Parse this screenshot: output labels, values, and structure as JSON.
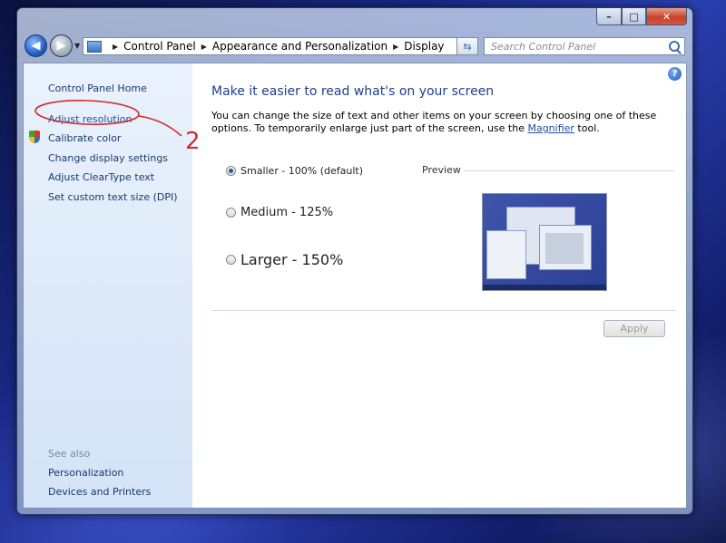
{
  "window": {
    "controls": {
      "minimize": "–",
      "maximize": "□",
      "close": "✕"
    }
  },
  "nav": {
    "back_glyph": "◀",
    "forward_glyph": "▶"
  },
  "address": {
    "crumbs": [
      "Control Panel",
      "Appearance and Personalization",
      "Display"
    ]
  },
  "search": {
    "placeholder": "Search Control Panel"
  },
  "sidebar": {
    "home": "Control Panel Home",
    "links": [
      "Adjust resolution",
      "Calibrate color",
      "Change display settings",
      "Adjust ClearType text",
      "Set custom text size (DPI)"
    ],
    "see_also_heading": "See also",
    "see_also": [
      "Personalization",
      "Devices and Printers"
    ]
  },
  "main": {
    "title": "Make it easier to read what's on your screen",
    "desc_part1": "You can change the size of text and other items on your screen by choosing one of these options. To temporarily enlarge just part of the screen, use the ",
    "desc_link": "Magnifier",
    "desc_part2": " tool.",
    "options": [
      {
        "label": "Smaller - 100% (default)",
        "selected": true
      },
      {
        "label": "Medium - 125%",
        "selected": false
      },
      {
        "label": "Larger - 150%",
        "selected": false
      }
    ],
    "preview_label": "Preview",
    "apply_label": "Apply"
  },
  "help_glyph": "?",
  "annotation": {
    "number": "2",
    "color": "#d42a2a"
  }
}
